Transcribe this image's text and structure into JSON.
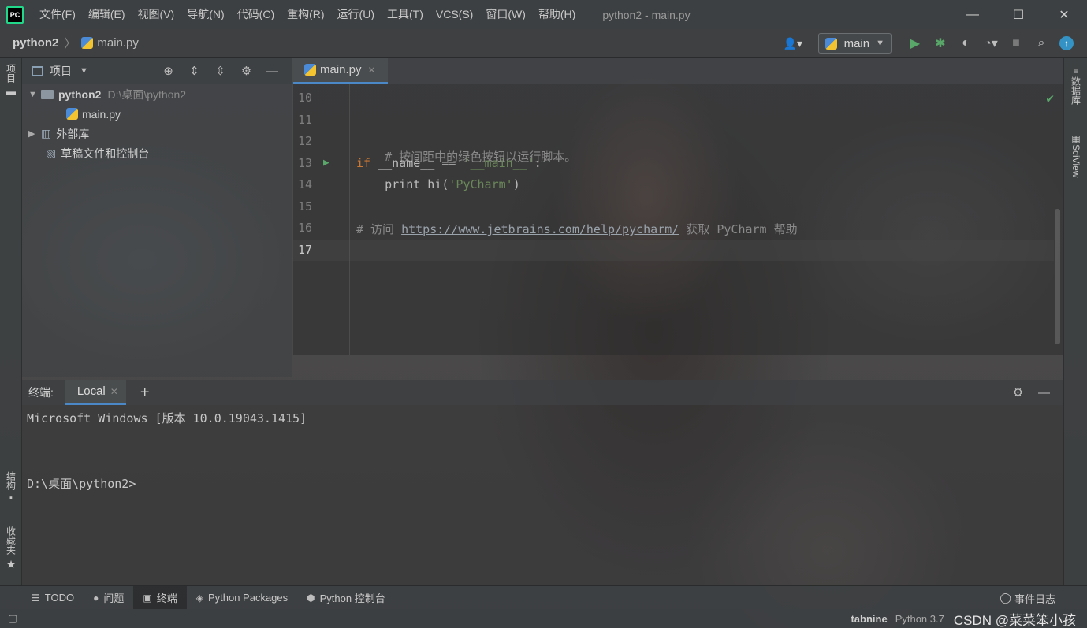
{
  "window": {
    "title": "python2 - main.py",
    "menu": [
      "文件(F)",
      "编辑(E)",
      "视图(V)",
      "导航(N)",
      "代码(C)",
      "重构(R)",
      "运行(U)",
      "工具(T)",
      "VCS(S)",
      "窗口(W)",
      "帮助(H)"
    ],
    "controls": {
      "minimize": "—",
      "maximize": "☐",
      "close": "✕"
    },
    "logo": "PC"
  },
  "navbar": {
    "project": "python2",
    "file": "main.py",
    "run_config": "main"
  },
  "left_strip": {
    "project_tab": "项目",
    "structure_tab": "结构",
    "favorites_tab": "收藏夹"
  },
  "right_strip": {
    "database_tab": "数据库",
    "sciview_tab": "SciView"
  },
  "project_panel": {
    "title": "项目",
    "tree": [
      {
        "label": "python2",
        "path": "D:\\桌面\\python2"
      },
      {
        "label": "main.py"
      },
      {
        "label": "外部库"
      },
      {
        "label": "草稿文件和控制台"
      }
    ]
  },
  "editor": {
    "tab": "main.py",
    "lines": [
      {
        "no": "10"
      },
      {
        "no": "11"
      },
      {
        "no": "12",
        "comment": "# 按间距中的绿色按钮以运行脚本。"
      },
      {
        "no": "13",
        "kw": "if",
        "rest": " __name__ == ",
        "str": "'__main__'",
        "end": ":"
      },
      {
        "no": "14",
        "indent": "    ",
        "call": "print_hi(",
        "str": "'PyCharm'",
        "end": ")"
      },
      {
        "no": "15"
      },
      {
        "no": "16",
        "pre": "# 访问 ",
        "url": "https://www.jetbrains.com/help/pycharm/",
        "post": " 获取 PyCharm 帮助"
      },
      {
        "no": "17"
      }
    ]
  },
  "terminal": {
    "label": "终端:",
    "tab": "Local",
    "lines": [
      "Microsoft Windows [版本 10.0.19043.1415]",
      "D:\\桌面\\python2>"
    ]
  },
  "bottom_tabs": [
    {
      "label": "TODO",
      "icon": "list-icon"
    },
    {
      "label": "问题",
      "icon": "info-icon"
    },
    {
      "label": "终端",
      "icon": "terminal-icon"
    },
    {
      "label": "Python Packages",
      "icon": "packages-icon"
    },
    {
      "label": "Python 控制台",
      "icon": "python-console-icon"
    }
  ],
  "event_log": "事件日志",
  "status": {
    "tabnine": "tabnine",
    "interpreter": "Python 3.7",
    "watermark": "CSDN @菜菜笨小孩"
  },
  "colors": {
    "accent": "#4a88c7",
    "run_green": "#59a869",
    "keyword": "#cc7832",
    "string": "#6a8759"
  }
}
